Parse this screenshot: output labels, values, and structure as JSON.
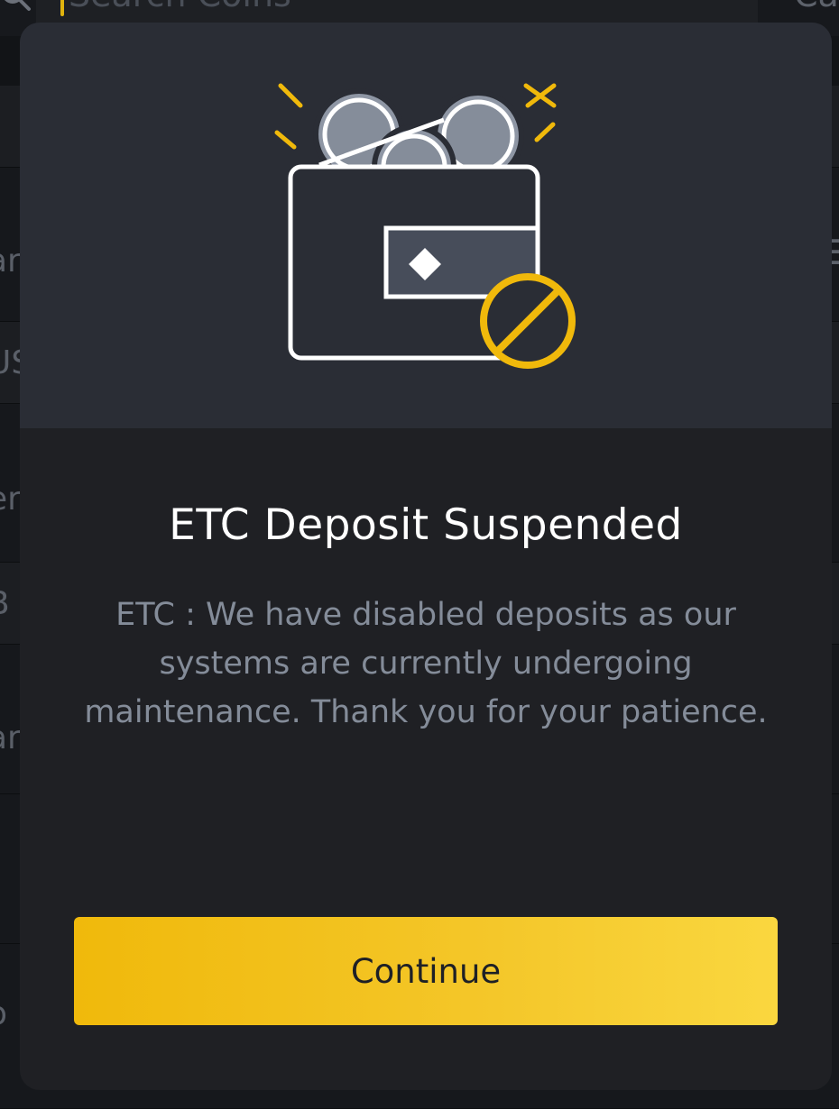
{
  "background": {
    "search_placeholder": "Search Coins",
    "right_partial_text": "Ca",
    "rows": [
      {
        "text": "ar"
      },
      {
        "text": "US"
      },
      {
        "text": "er"
      },
      {
        "text": "B"
      },
      {
        "text": "ar"
      },
      {
        "text": "."
      },
      {
        "text": "o"
      }
    ]
  },
  "modal": {
    "illustration": "wallet-disabled-icon",
    "title": "ETC Deposit Suspended",
    "message": "ETC : We have disabled deposits as our systems are currently undergoing maintenance. Thank you for your patience.",
    "continue_label": "Continue"
  },
  "colors": {
    "accent": "#f0b90b",
    "modal_bg": "#1f2024",
    "hero_bg": "#2a2d35",
    "message_text": "#848c99"
  }
}
